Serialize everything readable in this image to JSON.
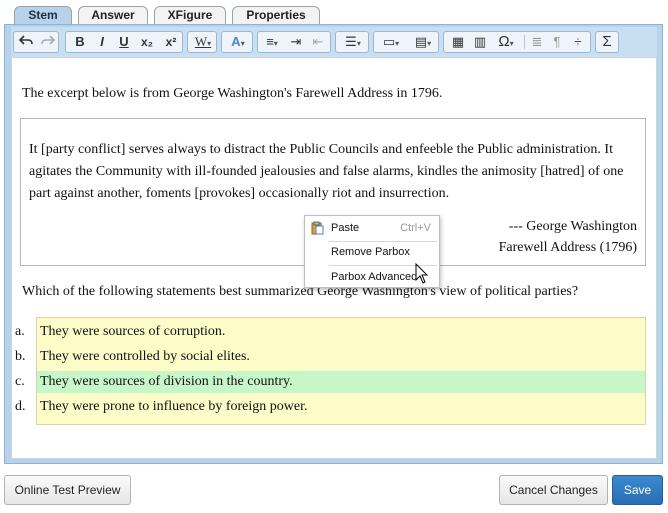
{
  "tabs": [
    "Stem",
    "Answer",
    "XFigure",
    "Properties"
  ],
  "toolbar": {
    "undo_icon": "undo-icon",
    "redo_icon": "redo-icon",
    "bold": "B",
    "italic": "I",
    "underline": "U",
    "subscript": "x₂",
    "superscript": "x²",
    "text_style": "W",
    "omega": "Ω",
    "pilcrow": "¶",
    "sigma": "Σ"
  },
  "content": {
    "intro": "The excerpt below is from George Washington's Farewell Address in 1796.",
    "quote_lines": [
      "It [party conflict] serves always to distract the Public Councils and enfeeble the Public administration. It",
      "agitates the Community with ill-founded jealousies and false alarms, kindles the animosity [hatred] of one",
      "part against another, foments [provokes] occasionally riot and insurrection."
    ],
    "attribution_author": "--- George Washington",
    "attribution_source": "Farewell Address (1796)",
    "question": "Which of the following statements best summarized George Washington's view of political parties?",
    "choices": [
      {
        "letter": "a.",
        "text": "They were sources of corruption."
      },
      {
        "letter": "b.",
        "text": "They were controlled by social elites."
      },
      {
        "letter": "c.",
        "text": "They were sources of division in the country."
      },
      {
        "letter": "d.",
        "text": "They were prone to influence by foreign power."
      }
    ],
    "highlight_color": "#c7f6c9",
    "choices_bg": "#fdfbc8"
  },
  "context_menu": {
    "paste_label": "Paste",
    "paste_shortcut": "Ctrl+V",
    "remove_label": "Remove Parbox",
    "advanced_label": "Parbox Advanced"
  },
  "footer": {
    "preview_label": "Online Test Preview",
    "cancel_label": "Cancel Changes",
    "save_label": "Save"
  }
}
